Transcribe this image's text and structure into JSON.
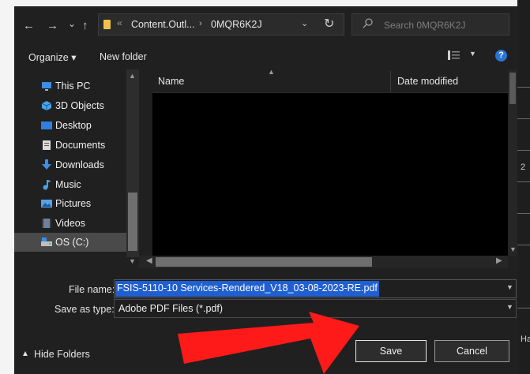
{
  "nav_buttons": {
    "back": "←",
    "forward": "→",
    "recent": "⌄",
    "up": "↑"
  },
  "address": {
    "separator": "«",
    "crumbs": [
      "Content.Outl...",
      "0MQR6K2J"
    ],
    "arrow": "›"
  },
  "search": {
    "placeholder": "Search 0MQR6K2J"
  },
  "toolbar": {
    "organize": "Organize ▾",
    "new_folder": "New folder",
    "help": "?"
  },
  "nav_pane": {
    "items": [
      {
        "label": "This PC",
        "icon": "monitor-icon"
      },
      {
        "label": "3D Objects",
        "icon": "cube-icon"
      },
      {
        "label": "Desktop",
        "icon": "desktop-icon"
      },
      {
        "label": "Documents",
        "icon": "document-icon"
      },
      {
        "label": "Downloads",
        "icon": "download-icon"
      },
      {
        "label": "Music",
        "icon": "music-icon"
      },
      {
        "label": "Pictures",
        "icon": "pictures-icon"
      },
      {
        "label": "Videos",
        "icon": "videos-icon"
      },
      {
        "label": "OS (C:)",
        "icon": "drive-icon"
      }
    ]
  },
  "file_list": {
    "columns": [
      "Name",
      "Date modified"
    ]
  },
  "file_name": {
    "label": "File name:",
    "value": "FSIS-5110-10 Services-Rendered_V18_03-08-2023-RE.pdf"
  },
  "save_as_type": {
    "label": "Save as type:",
    "value": "Adobe PDF Files (*.pdf)"
  },
  "hide_folders": "Hide Folders",
  "buttons": {
    "save": "Save",
    "cancel": "Cancel"
  },
  "background_fragments": [
    "2",
    "Ha"
  ],
  "colors": {
    "accent": "#1f5fd1",
    "annotation_arrow": "#ff1a1a",
    "help": "#2a74d5"
  }
}
